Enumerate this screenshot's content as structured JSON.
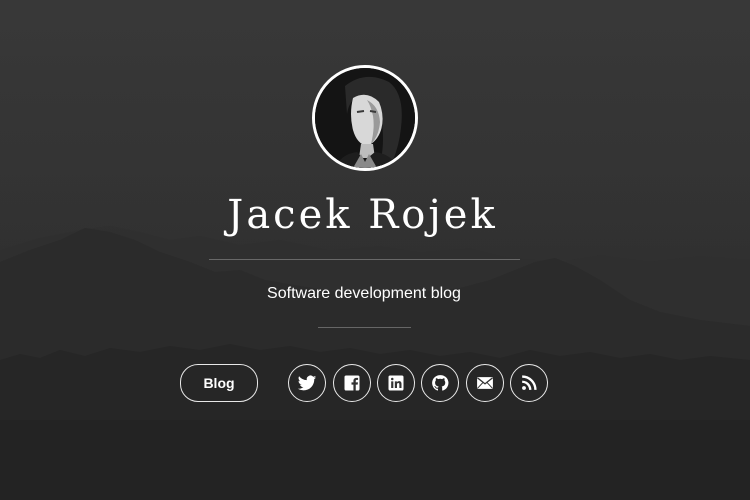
{
  "profile": {
    "name": "Jacek Rojek",
    "tagline": "Software development blog"
  },
  "nav": {
    "blog_label": "Blog"
  },
  "social_links": [
    {
      "icon": "twitter-icon"
    },
    {
      "icon": "facebook-icon"
    },
    {
      "icon": "linkedin-icon"
    },
    {
      "icon": "github-icon"
    },
    {
      "icon": "email-icon"
    },
    {
      "icon": "rss-icon"
    }
  ],
  "colors": {
    "background": "#2e2e2e",
    "text": "#ffffff",
    "border": "#e8e8e8"
  }
}
